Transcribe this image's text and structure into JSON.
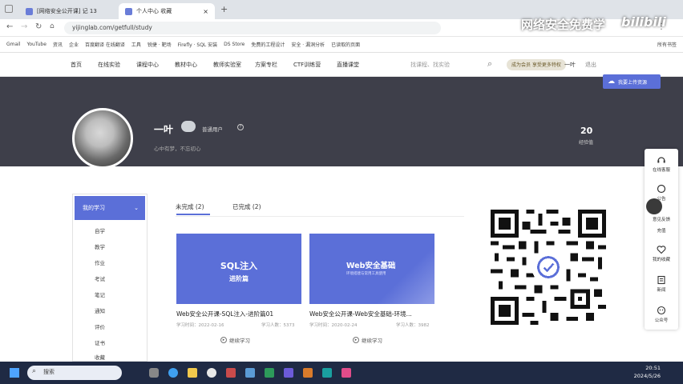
{
  "browser": {
    "tabs": [
      {
        "label": "[网络安全公开课] 记 13"
      },
      {
        "label": "个人中心 收藏"
      }
    ],
    "new_tab": "+",
    "url": "yijinglab.com/getfull/study",
    "bookmarks": [
      "Gmail",
      "YouTube",
      "资讯",
      "企业",
      "百度翻译 在线翻译",
      "工具",
      "锐捷 · 靶场",
      "Firefly · SQL 安装",
      "DS Store",
      "免费的工程设计",
      "安全 · 漏洞分析",
      "已读取的页面"
    ],
    "bookmarks_right": "所有书签"
  },
  "watermark": {
    "text": "网络安全免费学",
    "logo": "bilibili"
  },
  "site_nav": {
    "items": [
      "首页",
      "在线实验",
      "课程中心",
      "教材中心",
      "教师实验室",
      "方案专栏",
      "CTF训练营",
      "直播课堂"
    ],
    "search_placeholder": "找课程、找实验",
    "vip_label": "成为会员 享受更多特权",
    "user_label": "一叶",
    "user_extra": "退出"
  },
  "profile": {
    "name": "一叶",
    "badge": "普通用户",
    "subtitle": "心中有梦，不忘初心",
    "stat_value": "20",
    "stat_label": "经验值",
    "upload_button": "我要上传资源"
  },
  "sidebar": {
    "header": "我的学习",
    "items": [
      "自学",
      "教学",
      "作业",
      "考试",
      "笔记",
      "通知",
      "评价",
      "证书",
      "收藏"
    ]
  },
  "tabs": [
    {
      "label": "未完成 (2)"
    },
    {
      "label": "已完成 (2)"
    }
  ],
  "courses": [
    {
      "thumb_title": "SQL注入",
      "thumb_subtitle": "进阶篇",
      "title": "Web安全公开课-SQL注入-进阶篇01",
      "date": "学习时间：2022-02-16",
      "count": "学习人数：5373",
      "action": "继续学习"
    },
    {
      "thumb_title": "Web安全基础",
      "thumb_subtitle": "环境搭建与常用工具使用",
      "title": "Web安全公开课-Web安全基础-环境...",
      "date": "学习时间：2020-02-24",
      "count": "学习人数：3982",
      "action": "继续学习"
    }
  ],
  "right_rail": [
    {
      "label": "在线客服"
    },
    {
      "label": "公告"
    },
    {
      "label": "意见反馈"
    },
    {
      "label": "充值"
    },
    {
      "label": "我的收藏"
    },
    {
      "label": "新闻"
    },
    {
      "label": "公众号"
    }
  ],
  "taskbar": {
    "search": "搜索",
    "time": "20:51",
    "date": "2024/5/26"
  },
  "colors": {
    "banner": "#3e3f4a",
    "accent": "#5b6fd8",
    "taskbar": "#1f2a44"
  }
}
